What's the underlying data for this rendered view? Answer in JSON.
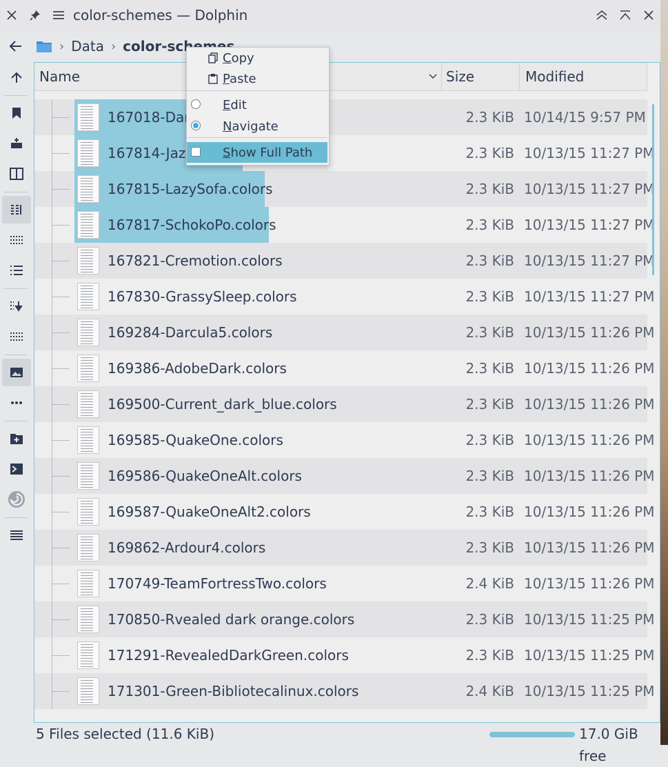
{
  "window": {
    "title": "color-schemes — Dolphin"
  },
  "breadcrumb": {
    "items": [
      "Data",
      "color-schemes"
    ]
  },
  "header": {
    "name": "Name",
    "size": "Size",
    "modified": "Modified"
  },
  "files": [
    {
      "name": "167018-Darc",
      "size": "2.3 KiB",
      "modified": "10/14/15 9:57 PM",
      "selected": true
    },
    {
      "name": "167814-Jazz",
      "size": "2.3 KiB",
      "modified": "10/13/15 11:27 PM",
      "selected": true
    },
    {
      "name": "167815-LazySofa.colors",
      "size": "2.3 KiB",
      "modified": "10/13/15 11:27 PM",
      "selected": true
    },
    {
      "name": "167817-SchokoPo.colors",
      "size": "2.3 KiB",
      "modified": "10/13/15 11:27 PM",
      "selected": true
    },
    {
      "name": "167821-Cremotion.colors",
      "size": "2.3 KiB",
      "modified": "10/13/15 11:27 PM",
      "selected": false
    },
    {
      "name": "167830-GrassySleep.colors",
      "size": "2.3 KiB",
      "modified": "10/13/15 11:27 PM",
      "selected": false
    },
    {
      "name": "169284-Darcula5.colors",
      "size": "2.3 KiB",
      "modified": "10/13/15 11:26 PM",
      "selected": false
    },
    {
      "name": "169386-AdobeDark.colors",
      "size": "2.3 KiB",
      "modified": "10/13/15 11:26 PM",
      "selected": false
    },
    {
      "name": "169500-Current_dark_blue.colors",
      "size": "2.3 KiB",
      "modified": "10/13/15 11:26 PM",
      "selected": false
    },
    {
      "name": "169585-QuakeOne.colors",
      "size": "2.3 KiB",
      "modified": "10/13/15 11:26 PM",
      "selected": false
    },
    {
      "name": "169586-QuakeOneAlt.colors",
      "size": "2.3 KiB",
      "modified": "10/13/15 11:26 PM",
      "selected": false
    },
    {
      "name": "169587-QuakeOneAlt2.colors",
      "size": "2.3 KiB",
      "modified": "10/13/15 11:26 PM",
      "selected": false
    },
    {
      "name": "169862-Ardour4.colors",
      "size": "2.3 KiB",
      "modified": "10/13/15 11:26 PM",
      "selected": false
    },
    {
      "name": "170749-TeamFortressTwo.colors",
      "size": "2.4 KiB",
      "modified": "10/13/15 11:26 PM",
      "selected": false
    },
    {
      "name": "170850-Rvealed dark orange.colors",
      "size": "2.3 KiB",
      "modified": "10/13/15 11:25 PM",
      "selected": false
    },
    {
      "name": "171291-RevealedDarkGreen.colors",
      "size": "2.3 KiB",
      "modified": "10/13/15 11:25 PM",
      "selected": false
    },
    {
      "name": "171301-Green-Bibliotecalinux.colors",
      "size": "2.4 KiB",
      "modified": "10/13/15 11:25 PM",
      "selected": false
    }
  ],
  "context_menu": {
    "items": [
      {
        "label": "Copy",
        "mnemonic": "C",
        "rest": "opy",
        "kind": "icon",
        "icon": "copy-icon"
      },
      {
        "label": "Paste",
        "mnemonic": "P",
        "rest": "aste",
        "kind": "icon",
        "icon": "paste-icon"
      },
      {
        "label": "Edit",
        "mnemonic": "E",
        "rest": "dit",
        "kind": "radio",
        "checked": false
      },
      {
        "label": "Navigate",
        "mnemonic": "N",
        "rest": "avigate",
        "kind": "radio",
        "checked": true
      },
      {
        "label": "Show Full Path",
        "mnemonic": "S",
        "rest": "how Full Path",
        "kind": "check",
        "checked": false,
        "highlighted": true
      }
    ]
  },
  "status": {
    "selection": "5 Files selected (11.6 KiB)",
    "free_space": "17.0 GiB free",
    "used_fraction": 1.0
  },
  "colors": {
    "selection": "#8fcadd",
    "accent": "#3daee9",
    "highlight": "#69bcd4"
  }
}
